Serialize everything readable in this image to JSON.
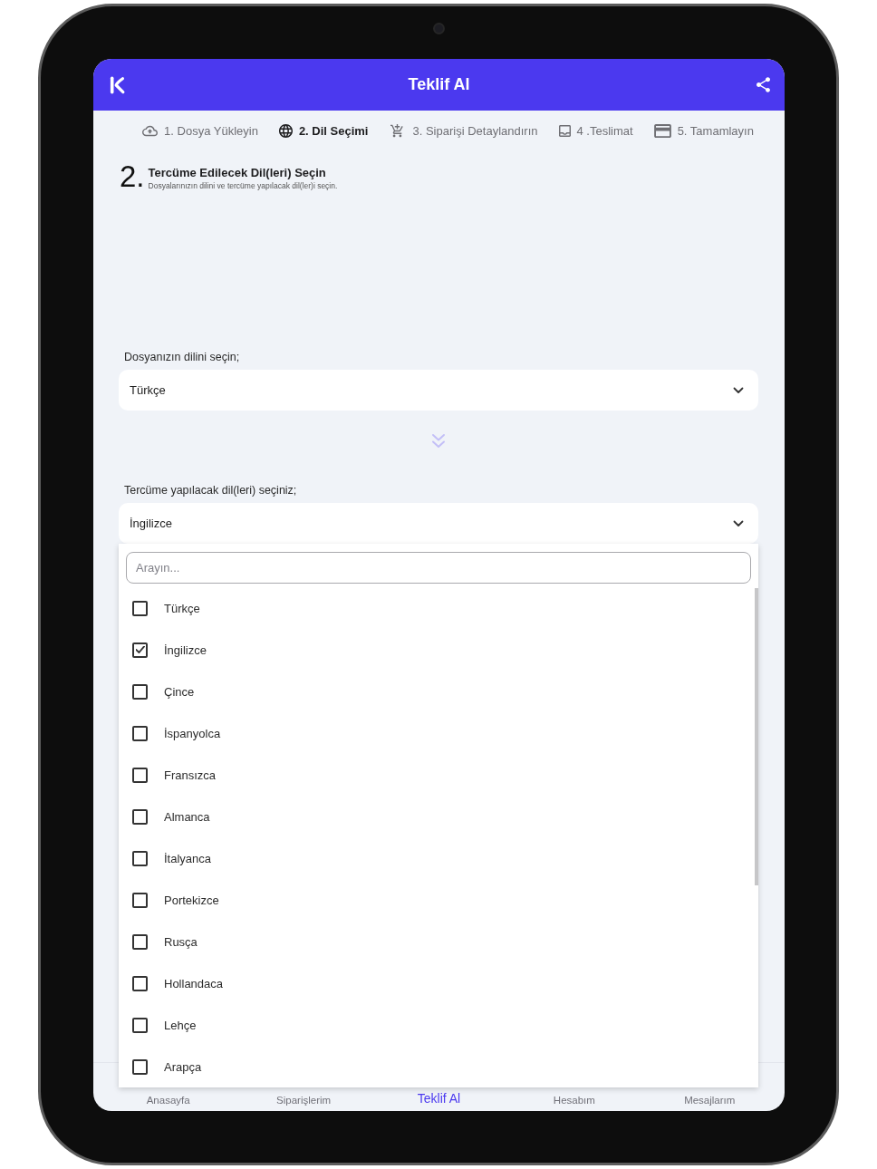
{
  "header": {
    "title": "Teklif Al"
  },
  "steps": [
    {
      "label": "1. Dosya Yükleyin",
      "selected": false
    },
    {
      "label": "2. Dil Seçimi",
      "selected": true
    },
    {
      "label": "3. Siparişi Detaylandırın",
      "selected": false
    },
    {
      "label": "4 .Teslimat",
      "selected": false
    },
    {
      "label": "5. Tamamlayın",
      "selected": false
    }
  ],
  "section": {
    "number": "2.",
    "title": "Tercüme Edilecek Dil(leri) Seçin",
    "subtitle": "Dosyalarınızın dilini ve tercüme yapılacak dil(ler)i seçin."
  },
  "source_language": {
    "label": "Dosyanızın dilini seçin;",
    "value": "Türkçe"
  },
  "target_languages": {
    "label": "Tercüme yapılacak dil(leri) seçiniz;",
    "value": "İngilizce",
    "expanded": true,
    "search": {
      "placeholder": "Arayın..."
    },
    "options": [
      {
        "label": "Türkçe",
        "checked": false
      },
      {
        "label": "İngilizce",
        "checked": true
      },
      {
        "label": "Çince",
        "checked": false
      },
      {
        "label": "İspanyolca",
        "checked": false
      },
      {
        "label": "Fransızca",
        "checked": false
      },
      {
        "label": "Almanca",
        "checked": false
      },
      {
        "label": "İtalyanca",
        "checked": false
      },
      {
        "label": "Portekizce",
        "checked": false
      },
      {
        "label": "Rusça",
        "checked": false
      },
      {
        "label": "Hollandaca",
        "checked": false
      },
      {
        "label": "Lehçe",
        "checked": false
      },
      {
        "label": "Arapça",
        "checked": false
      }
    ]
  },
  "bottom_nav": [
    {
      "label": "Anasayfa",
      "selected": false
    },
    {
      "label": "Siparişlerim",
      "selected": false
    },
    {
      "label": "Teklif Al",
      "selected": true
    },
    {
      "label": "Hesabım",
      "selected": false
    },
    {
      "label": "Mesajlarım",
      "selected": false
    }
  ]
}
